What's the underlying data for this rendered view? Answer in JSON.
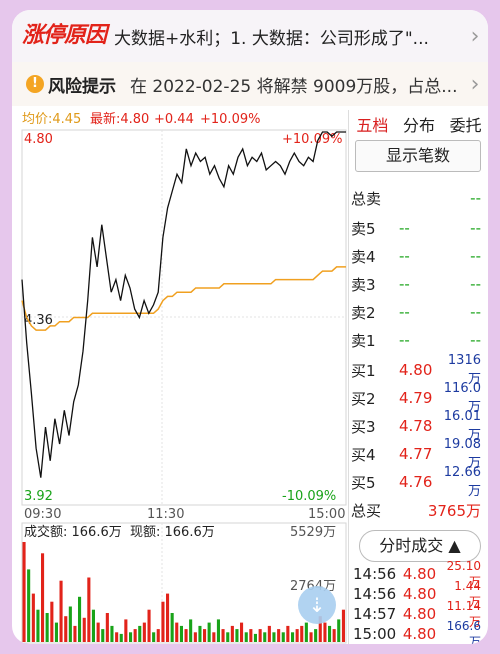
{
  "banner": {
    "logo_text": "涨停原因",
    "text": "大数据+水利；1. 大数据：公司形成了\"...",
    "chevron": "›"
  },
  "risk": {
    "icon": "!",
    "title": "风险提示",
    "text": "在 2022-02-25 将解禁 9009万股，占总..."
  },
  "chart_header": {
    "avg": "均价:4.45",
    "latest": "最新:4.80",
    "change": "+0.44",
    "pct": "+10.09%"
  },
  "axis": {
    "y_top": "4.80",
    "y_mid": "4.36",
    "y_bot": "3.92",
    "pct_top": "+10.09%",
    "pct_bot": "-10.09%",
    "t_start": "09:30",
    "t_mid": "11:30",
    "t_end": "15:00"
  },
  "volume_header": {
    "total": "成交额: 166.6万",
    "current": "现额: 166.6万",
    "max": "5529万",
    "mid": "2764万"
  },
  "side": {
    "tabs": [
      "五档",
      "分布",
      "委托"
    ],
    "show_button": "显示笔数",
    "total_sell_label": "总卖",
    "total_sell_value": "--",
    "sells": [
      {
        "label": "卖5",
        "price": "--",
        "vol": "--"
      },
      {
        "label": "卖4",
        "price": "--",
        "vol": "--"
      },
      {
        "label": "卖3",
        "price": "--",
        "vol": "--"
      },
      {
        "label": "卖2",
        "price": "--",
        "vol": "--"
      },
      {
        "label": "卖1",
        "price": "--",
        "vol": "--"
      }
    ],
    "buys": [
      {
        "label": "买1",
        "price": "4.80",
        "vol": "1316万"
      },
      {
        "label": "买2",
        "price": "4.79",
        "vol": "116.0万"
      },
      {
        "label": "买3",
        "price": "4.78",
        "vol": "16.01万"
      },
      {
        "label": "买4",
        "price": "4.77",
        "vol": "19.08万"
      },
      {
        "label": "买5",
        "price": "4.76",
        "vol": "12.66万"
      }
    ],
    "total_buy_label": "总买",
    "total_buy_value": "3765万",
    "ticks_button": "分时成交 ▲",
    "ticks": [
      {
        "time": "14:56",
        "price": "4.80",
        "vol": "25.10万"
      },
      {
        "time": "14:56",
        "price": "4.80",
        "vol": "1.44万"
      },
      {
        "time": "14:57",
        "price": "4.80",
        "vol": "11.14万"
      },
      {
        "time": "15:00",
        "price": "4.80",
        "vol": "166.6万"
      }
    ]
  },
  "colors": {
    "red": "#e2231a",
    "green": "#19a319",
    "blue": "#1d3ba0",
    "avg_line": "#f0a020",
    "price_line": "#111111"
  },
  "chart_data": {
    "type": "line",
    "ylim": [
      3.92,
      4.8
    ],
    "series": [
      {
        "values": [
          4.45,
          4.3,
          4.18,
          4.05,
          3.98,
          4.1,
          4.02,
          4.12,
          4.06,
          4.14,
          4.08,
          4.16,
          4.2,
          4.28,
          4.4,
          4.55,
          4.48,
          4.58,
          4.5,
          4.42,
          4.45,
          4.4,
          4.46,
          4.43,
          4.38,
          4.36,
          4.4,
          4.37,
          4.39,
          4.42,
          4.55,
          4.62,
          4.66,
          4.7,
          4.68,
          4.76,
          4.72,
          4.75,
          4.73,
          4.74,
          4.7,
          4.72,
          4.69,
          4.67,
          4.72,
          4.7,
          4.74,
          4.76,
          4.72,
          4.74,
          4.73,
          4.75,
          4.71,
          4.72,
          4.73,
          4.72,
          4.7,
          4.73,
          4.75,
          4.73,
          4.72,
          4.74,
          4.73,
          4.78,
          4.8,
          4.8,
          4.79,
          4.8,
          4.8,
          4.8
        ]
      },
      {
        "values": [
          4.4,
          4.36,
          4.34,
          4.33,
          4.33,
          4.33,
          4.34,
          4.34,
          4.35,
          4.35,
          4.35,
          4.36,
          4.36,
          4.36,
          4.36,
          4.37,
          4.37,
          4.37,
          4.37,
          4.37,
          4.37,
          4.37,
          4.37,
          4.37,
          4.37,
          4.37,
          4.37,
          4.37,
          4.37,
          4.38,
          4.4,
          4.41,
          4.41,
          4.42,
          4.42,
          4.42,
          4.42,
          4.43,
          4.43,
          4.43,
          4.43,
          4.43,
          4.43,
          4.44,
          4.44,
          4.44,
          4.44,
          4.44,
          4.44,
          4.44,
          4.44,
          4.44,
          4.44,
          4.44,
          4.45,
          4.45,
          4.45,
          4.45,
          4.45,
          4.45,
          4.45,
          4.45,
          4.45,
          4.46,
          4.47,
          4.47,
          4.47,
          4.48,
          4.48,
          4.48
        ]
      }
    ],
    "volumes": [
      62,
      45,
      30,
      20,
      55,
      18,
      25,
      12,
      38,
      16,
      22,
      10,
      28,
      15,
      40,
      20,
      12,
      8,
      18,
      10,
      6,
      5,
      14,
      6,
      8,
      10,
      12,
      20,
      6,
      8,
      25,
      30,
      18,
      12,
      10,
      8,
      14,
      6,
      10,
      8,
      12,
      6,
      14,
      8,
      6,
      10,
      8,
      12,
      6,
      8,
      5,
      8,
      6,
      10,
      6,
      8,
      6,
      10,
      6,
      8,
      10,
      12,
      6,
      8,
      16,
      12,
      10,
      8,
      14,
      20
    ],
    "volume_colors_red": [
      true,
      false,
      true,
      false,
      true,
      false,
      true,
      false,
      true,
      true,
      false,
      true,
      false,
      true,
      true,
      false,
      true,
      false,
      true,
      false,
      true,
      false,
      true,
      false,
      true,
      false,
      true,
      true,
      false,
      true,
      true,
      true,
      false,
      true,
      false,
      true,
      false,
      true,
      false,
      true,
      false,
      true,
      false,
      true,
      false,
      true,
      false,
      true,
      false,
      true,
      false,
      true,
      false,
      true,
      false,
      true,
      false,
      true,
      false,
      true,
      true,
      false,
      true,
      false,
      true,
      true,
      false,
      true,
      false,
      true
    ]
  }
}
